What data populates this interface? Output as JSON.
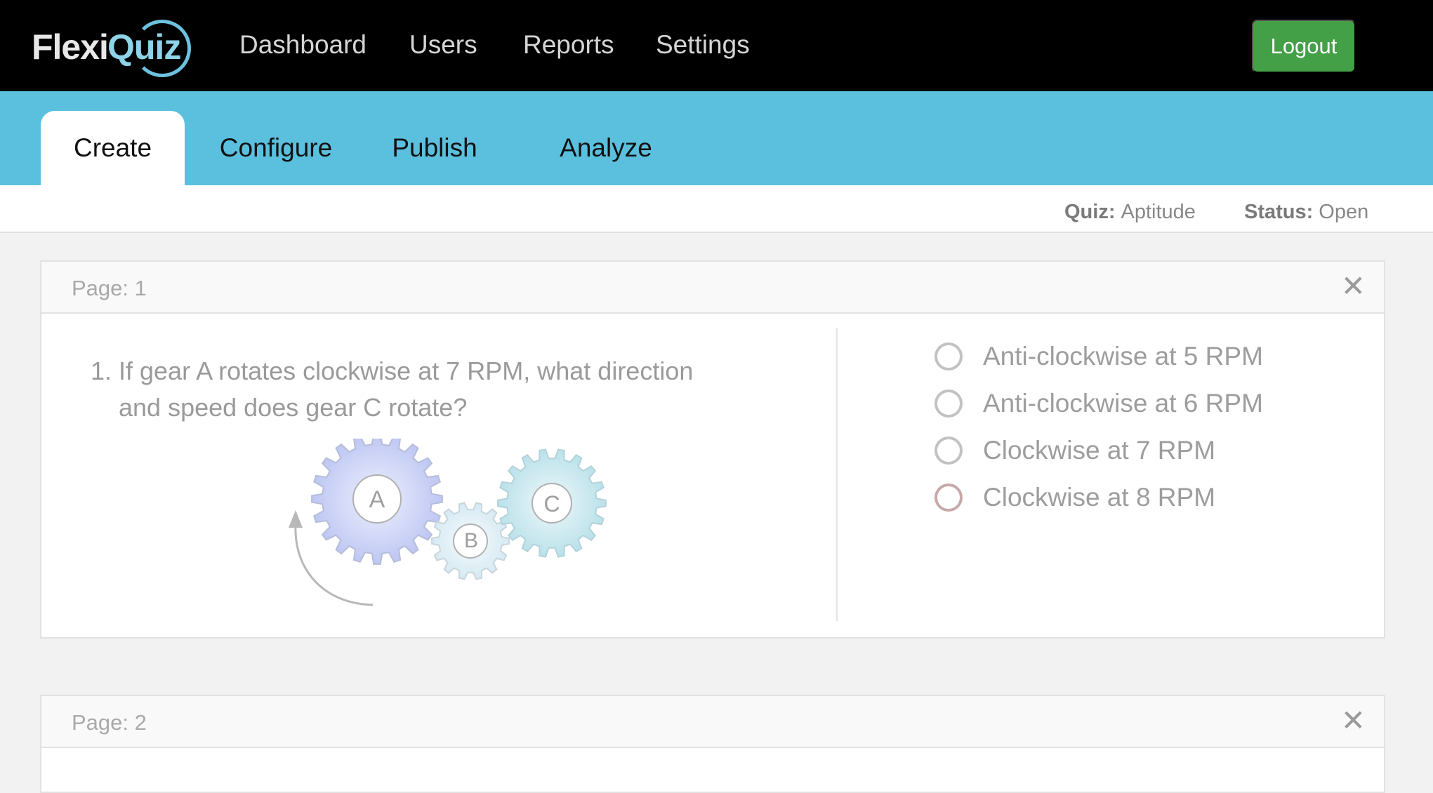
{
  "brand": {
    "part1": "Flexi",
    "part2": "Quiz"
  },
  "nav": {
    "items": [
      "Dashboard",
      "Users",
      "Reports",
      "Settings"
    ],
    "logout_label": "Logout"
  },
  "tabs": [
    "Create",
    "Configure",
    "Publish",
    "Analyze"
  ],
  "active_tab": "Create",
  "quiz_info": {
    "quiz_label": "Quiz:",
    "quiz_value": "Aptitude",
    "status_label": "Status:",
    "status_value": "Open"
  },
  "pages": [
    {
      "title": "Page: 1",
      "close_glyph": "✕",
      "question": {
        "number": "1.",
        "text": "If gear A rotates clockwise at 7 RPM, what direction and speed does gear C rotate?",
        "gear_labels": [
          "A",
          "B",
          "C"
        ],
        "options": [
          "Anti-clockwise at 5 RPM",
          "Anti-clockwise at 6 RPM",
          "Clockwise at 7 RPM",
          "Clockwise at 8 RPM"
        ]
      }
    },
    {
      "title": "Page: 2",
      "close_glyph": "✕"
    }
  ],
  "colors": {
    "topbar": "#000000",
    "tabbar": "#5bc0de",
    "logout": "#43a047",
    "gear_a": "#c4ccf3",
    "gear_b": "#e0eef5",
    "gear_c": "#c5e6ec",
    "last_radio_border": "#c7a9a9"
  }
}
